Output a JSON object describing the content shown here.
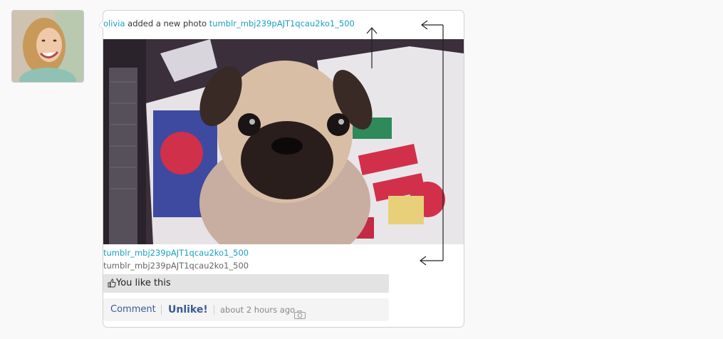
{
  "post": {
    "author": "olivia",
    "action_text": "added a new photo",
    "photo_title": "tumblr_mbj239pAJT1qcau2ko1_500",
    "caption_link": "tumblr_mbj239pAJT1qcau2ko1_500",
    "caption_text": "tumblr_mbj239pAJT1qcau2ko1_500",
    "likes_text": "You like this",
    "comment_label": "Comment",
    "unlike_label": "Unlike!",
    "timestamp": "about 2 hours ago"
  },
  "icons": {
    "thumb": "thumbs-up-icon",
    "camera": "camera-icon"
  },
  "colors": {
    "link": "#1a9ec2",
    "action": "#3b5998",
    "likes_bg": "#e3e3e3"
  }
}
